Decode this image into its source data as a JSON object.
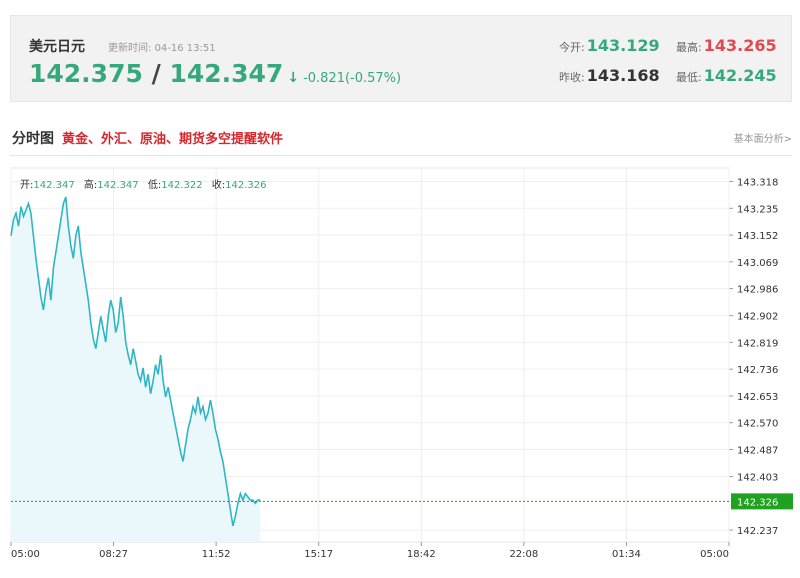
{
  "quote": {
    "name": "美元日元",
    "update_label": "更新时间:",
    "update_time": "04-16 13:51",
    "bid": "142.375",
    "separator": "/",
    "ask": "142.347",
    "arrow": "↓",
    "change": "-0.821(-0.57%)",
    "open_label": "今开:",
    "open": "143.129",
    "high_label": "最高:",
    "high": "143.265",
    "prev_close_label": "昨收:",
    "prev_close": "143.168",
    "low_label": "最低:",
    "low": "142.245"
  },
  "section": {
    "title": "分时图",
    "promo": "黄金、外汇、原油、期货多空提醒软件",
    "fundamentals_link": "基本面分析>"
  },
  "ohlc": {
    "open_label": "开:",
    "open": "142.347",
    "high_label": "高:",
    "high": "142.347",
    "low_label": "低:",
    "low": "142.322",
    "close_label": "收:",
    "close": "142.326"
  },
  "colors": {
    "up": "#e3474f",
    "down": "#36a97c",
    "line": "#2fb6c5",
    "area": "#eaf7fb",
    "current": "#1fa21f"
  },
  "chart_data": {
    "type": "area",
    "x_tick_labels": [
      "05:00",
      "08:27",
      "11:52",
      "15:17",
      "18:42",
      "22:08",
      "01:34",
      "05:00"
    ],
    "y_tick_labels": [
      "143.318",
      "143.235",
      "143.152",
      "143.069",
      "142.986",
      "142.902",
      "142.819",
      "142.736",
      "142.653",
      "142.570",
      "142.487",
      "142.403",
      "142.237"
    ],
    "ylim": [
      142.2,
      143.36
    ],
    "current_value": 142.326,
    "current_label": "142.326",
    "grid": true,
    "series": [
      {
        "x_minutes": [
          0,
          5,
          10,
          15,
          20,
          25,
          30,
          35,
          40,
          45,
          50,
          55,
          60,
          65,
          70,
          75,
          80,
          85,
          90,
          95,
          100,
          105,
          110,
          115,
          120,
          125,
          130,
          135,
          140,
          145,
          150,
          155,
          160,
          165,
          170,
          175,
          180,
          185,
          190,
          195,
          200,
          205,
          210,
          215,
          220,
          225,
          230,
          235,
          240,
          245,
          250,
          255,
          260,
          265,
          270,
          275,
          280,
          285,
          290,
          295,
          300,
          305,
          310,
          315,
          320,
          325,
          330,
          335,
          340,
          345,
          350,
          355,
          360,
          365,
          370,
          375,
          380,
          385,
          390,
          395,
          400,
          405,
          410,
          415,
          420,
          425,
          430,
          435,
          440,
          445,
          450,
          455,
          460,
          465,
          470,
          475,
          480,
          485,
          490,
          495,
          500
        ],
        "values": [
          143.15,
          143.2,
          143.22,
          143.18,
          143.24,
          143.21,
          143.23,
          143.25,
          143.22,
          143.15,
          143.08,
          143.02,
          142.96,
          142.92,
          142.98,
          143.02,
          142.95,
          143.05,
          143.1,
          143.15,
          143.2,
          143.25,
          143.27,
          143.18,
          143.12,
          143.08,
          143.15,
          143.18,
          143.1,
          143.05,
          143.0,
          142.95,
          142.88,
          142.83,
          142.8,
          142.85,
          142.9,
          142.86,
          142.82,
          142.9,
          142.95,
          142.92,
          142.85,
          142.88,
          142.96,
          142.9,
          142.82,
          142.78,
          142.75,
          142.8,
          142.76,
          142.72,
          142.7,
          142.74,
          142.68,
          142.72,
          142.66,
          142.7,
          142.75,
          142.72,
          142.78,
          142.7,
          142.65,
          142.68,
          142.64,
          142.6,
          142.56,
          142.52,
          142.48,
          142.45,
          142.5,
          142.55,
          142.58,
          142.62,
          142.6,
          142.65,
          142.6,
          142.62,
          142.58,
          142.6,
          142.64,
          142.6,
          142.55,
          142.52,
          142.48,
          142.45,
          142.4,
          142.35,
          142.3,
          142.25,
          142.28,
          142.32,
          142.35,
          142.33,
          142.35,
          142.34,
          142.33,
          142.33,
          142.32,
          142.33,
          142.33
        ]
      }
    ]
  }
}
